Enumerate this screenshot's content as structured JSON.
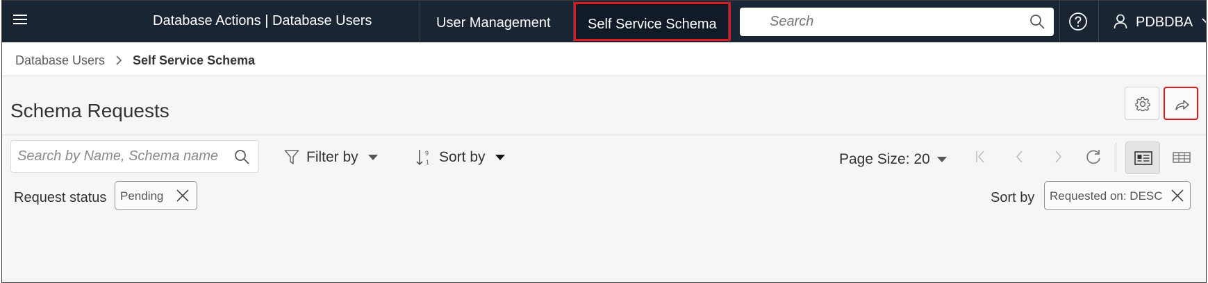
{
  "header": {
    "menu_icon": "hamburger-menu-icon",
    "brand": "Database Actions |  Database Users",
    "nav": {
      "user_management": "User Management",
      "self_service_schema": "Self Service Schema"
    },
    "search_placeholder": "Search",
    "user_name": "PDBDBA"
  },
  "breadcrumb": {
    "parent": "Database Users",
    "current": "Self Service Schema"
  },
  "page": {
    "title": "Schema Requests"
  },
  "toolbar": {
    "search_placeholder": "Search by Name, Schema name",
    "filter_label": "Filter by",
    "sort_label": "Sort by",
    "page_size_label": "Page Size: 20"
  },
  "filters": {
    "request_status_label": "Request status",
    "status_chip": "Pending",
    "sort_by_label": "Sort by",
    "sort_chip": "Requested on: DESC"
  },
  "colors": {
    "navbar": "#1a2533",
    "highlight": "#e0191f",
    "background": "#f6f6f6"
  }
}
